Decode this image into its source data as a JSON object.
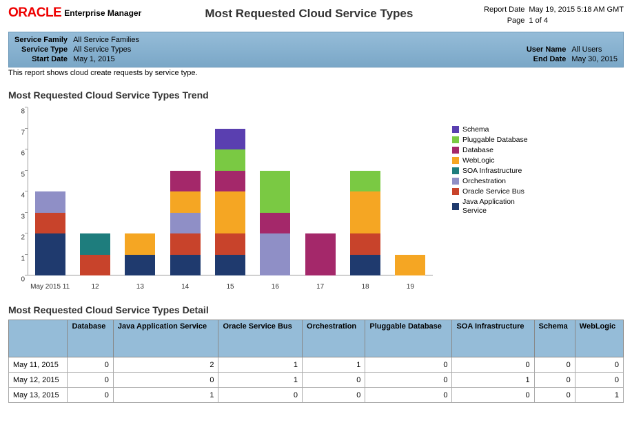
{
  "header": {
    "logo_text": "ORACLE",
    "logo_sub": "Enterprise Manager",
    "report_title": "Most Requested Cloud Service Types",
    "report_date_label": "Report Date",
    "report_date_value": "May 19, 2015 5:18 AM GMT",
    "page_label": "Page",
    "page_value": "1 of 4"
  },
  "filters": {
    "left": [
      {
        "label": "Service Family",
        "value": "All Service Families"
      },
      {
        "label": "Service Type",
        "value": "All Service Types"
      },
      {
        "label": "Start Date",
        "value": "May 1, 2015"
      }
    ],
    "right": [
      {
        "label": "User Name",
        "value": "All Users"
      },
      {
        "label": "End Date",
        "value": "May 30, 2015"
      }
    ]
  },
  "subtitle": "This report shows cloud create requests by service type.",
  "trend_title": "Most Requested Cloud Service Types Trend",
  "detail_title": "Most Requested Cloud Service Types Detail",
  "chart_data": {
    "type": "bar",
    "stacked": true,
    "ylim": [
      0,
      8
    ],
    "yticks": [
      0,
      1,
      2,
      3,
      4,
      5,
      6,
      7,
      8
    ],
    "categories": [
      "May 2015 11",
      "12",
      "13",
      "14",
      "15",
      "16",
      "17",
      "18",
      "19"
    ],
    "series": [
      {
        "name": "Java Application Service",
        "color": "#1f3a6e",
        "values": [
          2,
          0,
          1,
          1,
          1,
          0,
          0,
          1,
          0
        ]
      },
      {
        "name": "Oracle Service Bus",
        "color": "#c8432b",
        "values": [
          1,
          1,
          0,
          1,
          1,
          0,
          0,
          1,
          0
        ]
      },
      {
        "name": "Orchestration",
        "color": "#8f8fc6",
        "values": [
          1,
          0,
          0,
          1,
          0,
          2,
          0,
          0,
          0
        ]
      },
      {
        "name": "SOA Infrastructure",
        "color": "#1e7d7d",
        "values": [
          0,
          1,
          0,
          0,
          0,
          0,
          0,
          0,
          0
        ]
      },
      {
        "name": "WebLogic",
        "color": "#f5a623",
        "values": [
          0,
          0,
          1,
          1,
          2,
          0,
          0,
          2,
          1
        ]
      },
      {
        "name": "Database",
        "color": "#a4286a",
        "values": [
          0,
          0,
          0,
          1,
          1,
          1,
          2,
          0,
          0
        ]
      },
      {
        "name": "Pluggable Database",
        "color": "#7ac943",
        "values": [
          0,
          0,
          0,
          0,
          1,
          2,
          0,
          1,
          0
        ]
      },
      {
        "name": "Schema",
        "color": "#5a3fb0",
        "values": [
          0,
          0,
          0,
          0,
          1,
          0,
          0,
          0,
          0
        ]
      }
    ],
    "legend_order": [
      "Schema",
      "Pluggable Database",
      "Database",
      "WebLogic",
      "SOA Infrastructure",
      "Orchestration",
      "Oracle Service Bus",
      "Java Application Service"
    ]
  },
  "detail_table": {
    "columns": [
      "",
      "Database",
      "Java Application Service",
      "Oracle Service Bus",
      "Orchestration",
      "Pluggable Database",
      "SOA Infrastructure",
      "Schema",
      "WebLogic"
    ],
    "rows": [
      {
        "date": "May 11, 2015",
        "values": [
          0,
          2,
          1,
          1,
          0,
          0,
          0,
          0
        ]
      },
      {
        "date": "May 12, 2015",
        "values": [
          0,
          0,
          1,
          0,
          0,
          1,
          0,
          0
        ]
      },
      {
        "date": "May 13, 2015",
        "values": [
          0,
          1,
          0,
          0,
          0,
          0,
          0,
          1
        ]
      }
    ]
  }
}
